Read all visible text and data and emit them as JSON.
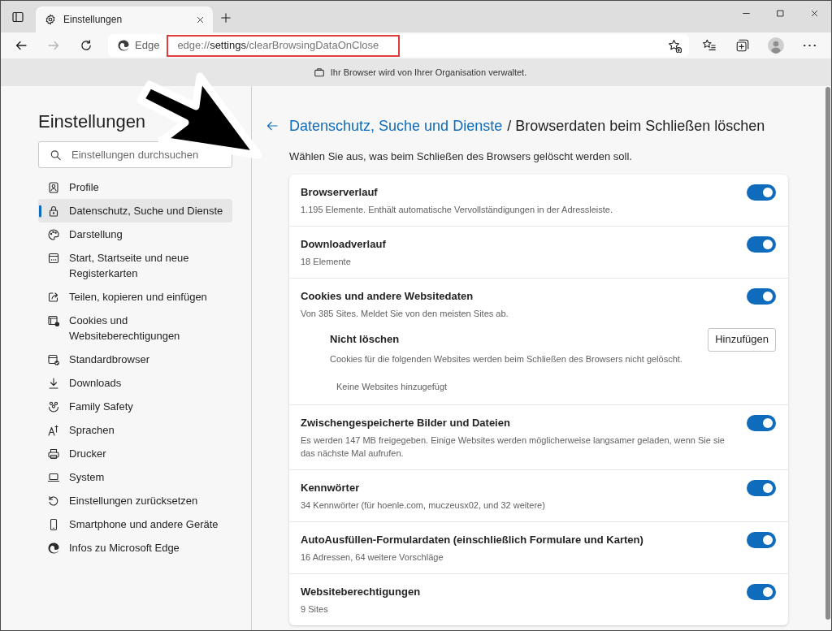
{
  "browser": {
    "tabs": [
      {
        "title": "Einstellungen",
        "selected": true
      }
    ],
    "nav_buttons": [
      {
        "kind": "back",
        "disabled": false
      },
      {
        "kind": "forward",
        "disabled": true
      },
      {
        "kind": "refresh",
        "disabled": false
      }
    ],
    "address_bar": {
      "site_label": "Edge",
      "url": {
        "scheme": "edge://",
        "host": "settings",
        "path": "/clearBrowsingDataOnClose"
      }
    },
    "info_bar": {
      "text": "Ihr Browser wird von Ihrer Organisation verwaltet."
    }
  },
  "sidebar": {
    "title": "Einstellungen",
    "search": {
      "placeholder": "Einstellungen durchsuchen"
    },
    "items": [
      {
        "label": "Profile",
        "selected": false
      },
      {
        "label": "Datenschutz, Suche und Dienste",
        "selected": true
      },
      {
        "label": "Darstellung",
        "selected": false
      },
      {
        "label": "Start, Startseite und neue Registerkarten",
        "selected": false
      },
      {
        "label": "Teilen, kopieren und einfügen",
        "selected": false
      },
      {
        "label": "Cookies und Websiteberechtigungen",
        "selected": false
      },
      {
        "label": "Standardbrowser",
        "selected": false
      },
      {
        "label": "Downloads",
        "selected": false
      },
      {
        "label": "Family Safety",
        "selected": false
      },
      {
        "label": "Sprachen",
        "selected": false
      },
      {
        "label": "Drucker",
        "selected": false
      },
      {
        "label": "System",
        "selected": false
      },
      {
        "label": "Einstellungen zurücksetzen",
        "selected": false
      },
      {
        "label": "Smartphone und andere Geräte",
        "selected": false
      },
      {
        "label": "Infos zu Microsoft Edge",
        "selected": false
      }
    ]
  },
  "main": {
    "breadcrumb": {
      "parent": "Datenschutz, Suche und Dienste",
      "current": "/ Browserdaten beim Schließen löschen"
    },
    "description": "Wählen Sie aus, was beim Schließen des Browsers gelöscht werden soll.",
    "settings": [
      {
        "kind": "toggle",
        "title": "Browserverlauf",
        "description": "1.195 Elemente. Enthält automatische Vervollständigungen in der Adressleiste.",
        "on": true
      },
      {
        "kind": "toggle",
        "title": "Downloadverlauf",
        "description": "18 Elemente",
        "on": true
      },
      {
        "kind": "toggle-with-exceptions",
        "title": "Cookies und andere Websitedaten",
        "description": "Von 385 Sites. Meldet Sie von den meisten Sites ab.",
        "on": true,
        "exceptions": {
          "title": "Nicht löschen",
          "description": "Cookies für die folgenden Websites werden beim Schließen des Browsers nicht gelöscht.",
          "button": "Hinzufügen",
          "empty_text": "Keine Websites hinzugefügt"
        }
      },
      {
        "kind": "toggle",
        "title": "Zwischengespeicherte Bilder und Dateien",
        "description": "Es werden 147 MB freigegeben. Einige Websites werden möglicherweise langsamer geladen, wenn Sie sie das nächste Mal aufrufen.",
        "on": true
      },
      {
        "kind": "toggle",
        "title": "Kennwörter",
        "description": "34 Kennwörter (für hoenle.com, muczeusx02, und 32 weitere)",
        "on": true
      },
      {
        "kind": "toggle",
        "title": "AutoAusfüllen-Formulardaten (einschließlich Formulare und Karten)",
        "description": "16 Adressen, 64 weitere Vorschläge",
        "on": true
      },
      {
        "kind": "toggle",
        "title": "Websiteberechtigungen",
        "description": "9 Sites",
        "on": true
      }
    ]
  }
}
